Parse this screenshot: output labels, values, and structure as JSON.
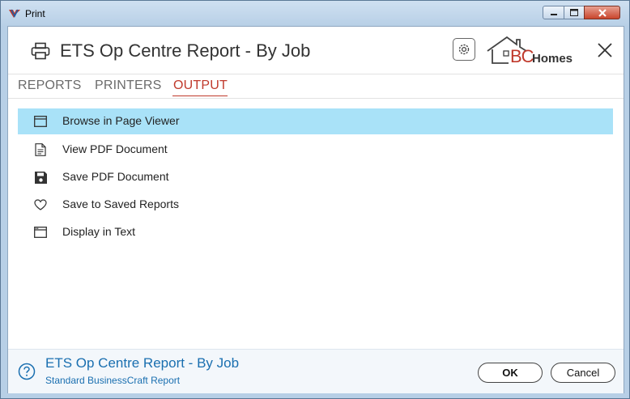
{
  "window": {
    "title": "Print"
  },
  "header": {
    "report_title": "ETS Op Centre Report - By Job",
    "logo": {
      "text_bc": "BC",
      "text_homes": "Homes",
      "colors": {
        "bc": "#c0392b",
        "homes": "#333333"
      }
    }
  },
  "tabs": [
    {
      "label": "REPORTS",
      "active": false
    },
    {
      "label": "PRINTERS",
      "active": false
    },
    {
      "label": "OUTPUT",
      "active": true
    }
  ],
  "output_options": [
    {
      "label": "Browse in Page Viewer",
      "icon": "page-viewer-icon",
      "selected": true
    },
    {
      "label": "View PDF Document",
      "icon": "document-icon",
      "selected": false
    },
    {
      "label": "Save PDF Document",
      "icon": "save-disk-icon",
      "selected": false
    },
    {
      "label": "Save to Saved Reports",
      "icon": "heart-icon",
      "selected": false
    },
    {
      "label": "Display in Text",
      "icon": "text-window-icon",
      "selected": false
    }
  ],
  "footer": {
    "title": "ETS Op Centre Report - By Job",
    "subtitle": "Standard BusinessCraft Report",
    "ok_label": "OK",
    "cancel_label": "Cancel"
  },
  "colors": {
    "accent_tab": "#c0392b",
    "selection": "#a9e2f8",
    "footer_text": "#1a6fb0"
  }
}
